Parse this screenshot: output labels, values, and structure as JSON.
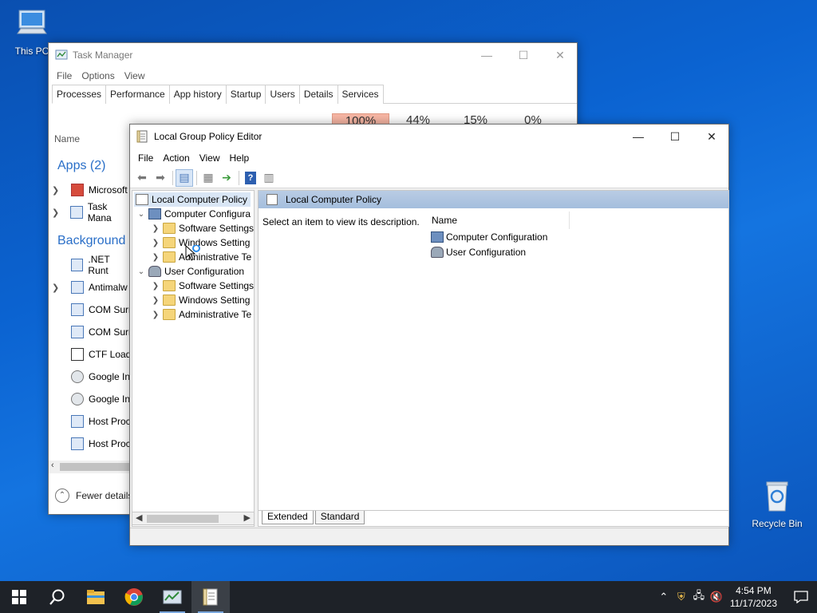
{
  "desktop": {
    "icons": [
      {
        "label": "This PC"
      },
      {
        "label": "Recycle Bin"
      }
    ]
  },
  "taskmgr": {
    "title": "Task Manager",
    "menu": [
      "File",
      "Options",
      "View"
    ],
    "tabs": [
      "Processes",
      "Performance",
      "App history",
      "Startup",
      "Users",
      "Details",
      "Services"
    ],
    "metrics": [
      "100%",
      "44%",
      "15%",
      "0%"
    ],
    "column_name": "Name",
    "apps_header": "Apps (2)",
    "apps": [
      "Microsoft",
      "Task Mana"
    ],
    "background_header": "Background",
    "background": [
      ".NET Runt",
      "Antimalw",
      "COM Surr",
      "COM Surr",
      "CTF Load",
      "Google In",
      "Google In",
      "Host Proc",
      "Host Proc"
    ],
    "fewer_details": "Fewer details"
  },
  "gpedit": {
    "title": "Local Group Policy Editor",
    "menu": [
      "File",
      "Action",
      "View",
      "Help"
    ],
    "tree": {
      "root": "Local Computer Policy",
      "computer": "Computer Configura",
      "computer_children": [
        "Software Settings",
        "Windows Setting",
        "Administrative Te"
      ],
      "user": "User Configuration",
      "user_children": [
        "Software Settings",
        "Windows Setting",
        "Administrative Te"
      ]
    },
    "right": {
      "header": "Local Computer Policy",
      "description": "Select an item to view its description.",
      "column": "Name",
      "items": [
        "Computer Configuration",
        "User Configuration"
      ]
    },
    "bottom_tabs": [
      "Extended",
      "Standard"
    ]
  },
  "taskbar": {
    "time": "4:54 PM",
    "date": "11/17/2023"
  }
}
